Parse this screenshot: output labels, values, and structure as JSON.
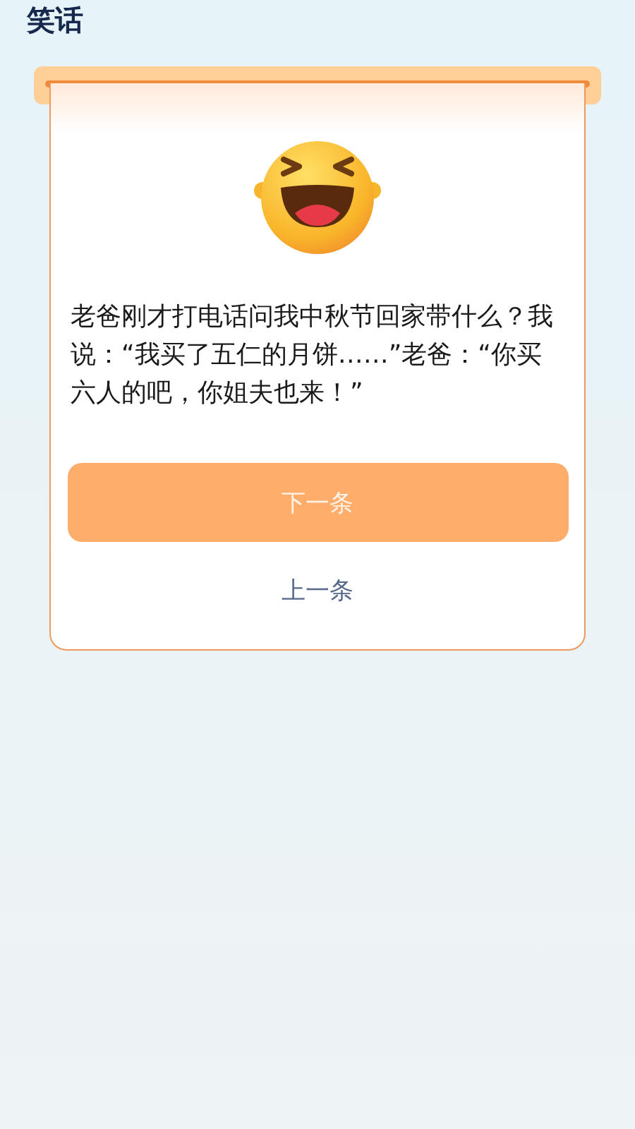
{
  "header": {
    "title": "笑话"
  },
  "joke": {
    "text": "老爸刚才打电话问我中秋节回家带什么？我说：“我买了五仁的月饼……”老爸：“你买六人的吧，你姐夫也来！”"
  },
  "buttons": [
    {
      "kind": "primary",
      "label": "下一条"
    },
    {
      "kind": "link",
      "label": "上一条"
    }
  ]
}
